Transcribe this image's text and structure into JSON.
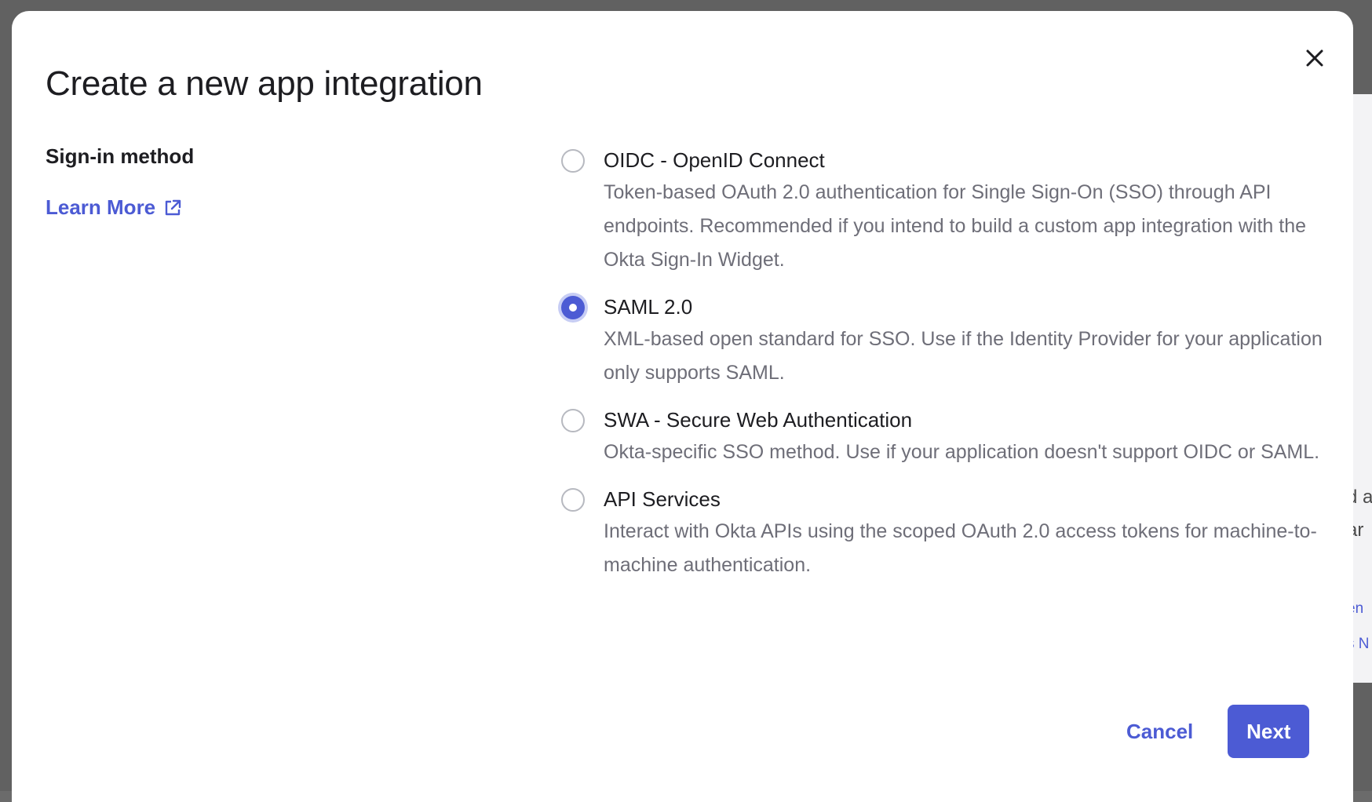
{
  "background": {
    "snippets": [
      "d a",
      "ar",
      "en",
      "s N"
    ]
  },
  "modal": {
    "title": "Create a new app integration",
    "close_icon": "close-icon",
    "section_label": "Sign-in method",
    "learn_more_label": "Learn More",
    "learn_more_icon": "external-link-icon",
    "options": [
      {
        "title": "OIDC - OpenID Connect",
        "description": "Token-based OAuth 2.0 authentication for Single Sign-On (SSO) through API endpoints. Recommended if you intend to build a custom app integration with the Okta Sign-In Widget.",
        "selected": false
      },
      {
        "title": "SAML 2.0",
        "description": "XML-based open standard for SSO. Use if the Identity Provider for your application only supports SAML.",
        "selected": true
      },
      {
        "title": "SWA - Secure Web Authentication",
        "description": "Okta-specific SSO method. Use if your application doesn't support OIDC or SAML.",
        "selected": false
      },
      {
        "title": "API Services",
        "description": "Interact with Okta APIs using the scoped OAuth 2.0 access tokens for machine-to-machine authentication.",
        "selected": false
      }
    ],
    "cancel_label": "Cancel",
    "next_label": "Next"
  },
  "colors": {
    "accent": "#4c5bd4",
    "text_primary": "#1d1d21",
    "text_secondary": "#6e6e78",
    "backdrop": "#616161"
  }
}
